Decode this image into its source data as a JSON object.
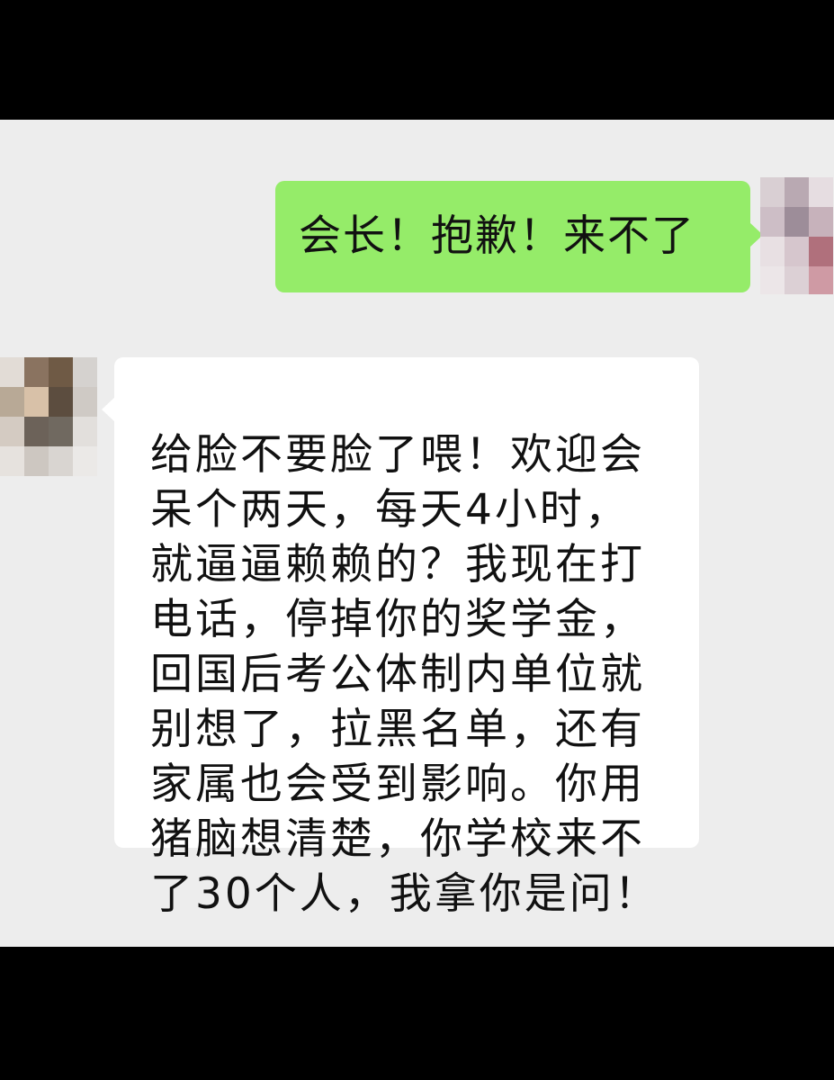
{
  "messages": [
    {
      "direction": "sent",
      "text": "会长！抱歉！来不了",
      "bubble_color": "#95ec69"
    },
    {
      "direction": "received",
      "text": "给脸不要脸了喂！欢迎会\n呆个两天，每天4小时，\n就逼逼赖赖的？我现在打\n电话，停掉你的奖学金，\n回国后考公体制内单位就\n别想了，拉黑名单，还有\n家属也会受到影响。你用\n猪脑想清楚，你学校来不\n了30个人，我拿你是问！",
      "bubble_color": "#ffffff"
    }
  ],
  "avatars": {
    "sent": "pixelated-avatar",
    "received": "pixelated-avatar"
  },
  "colors": {
    "chat_background": "#ededed",
    "letterbox": "#000000"
  }
}
